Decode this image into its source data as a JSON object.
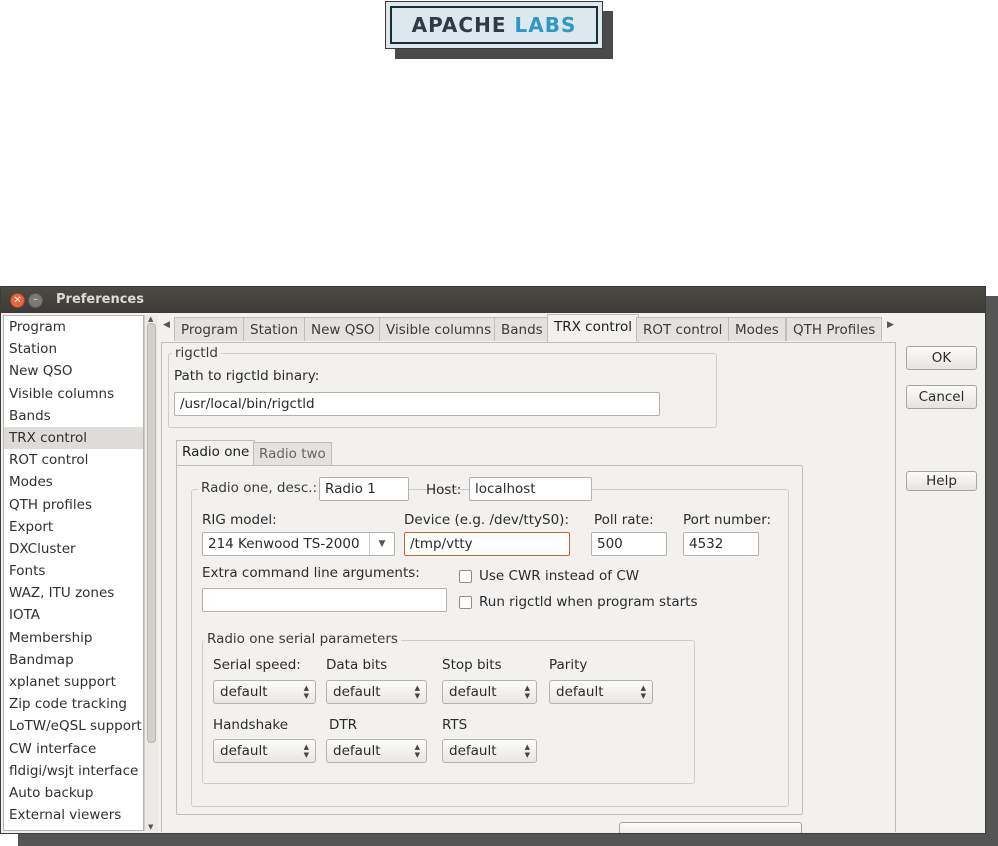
{
  "logo": {
    "apache": "APACHE",
    "labs": "LABS"
  },
  "window": {
    "title": "Preferences"
  },
  "sidebar": {
    "items": [
      {
        "label": "Program"
      },
      {
        "label": "Station"
      },
      {
        "label": "New QSO"
      },
      {
        "label": "Visible columns"
      },
      {
        "label": "Bands"
      },
      {
        "label": "TRX control"
      },
      {
        "label": "ROT control"
      },
      {
        "label": "Modes"
      },
      {
        "label": "QTH profiles"
      },
      {
        "label": "Export"
      },
      {
        "label": "DXCluster"
      },
      {
        "label": "Fonts"
      },
      {
        "label": "WAZ, ITU zones"
      },
      {
        "label": "IOTA"
      },
      {
        "label": "Membership"
      },
      {
        "label": "Bandmap"
      },
      {
        "label": "xplanet support"
      },
      {
        "label": "Zip code tracking"
      },
      {
        "label": "LoTW/eQSL support"
      },
      {
        "label": "CW interface"
      },
      {
        "label": "fldigi/wsjt interface"
      },
      {
        "label": "Auto backup"
      },
      {
        "label": "External viewers"
      }
    ],
    "selected": "TRX control"
  },
  "tabs": [
    "Program",
    "Station",
    "New QSO",
    "Visible columns",
    "Bands",
    "TRX control",
    "ROT control",
    "Modes",
    "QTH Profiles"
  ],
  "active_tab": "TRX control",
  "rigctld": {
    "group_title": "rigctld",
    "path_label": "Path to rigctld binary:",
    "path_value": "/usr/local/bin/rigctld"
  },
  "radio_tabs": [
    "Radio one",
    "Radio two"
  ],
  "radio": {
    "desc_label": "Radio one, desc.:",
    "desc_value": "Radio 1",
    "host_label": "Host:",
    "host_value": "localhost",
    "rig_model_label": "RIG model:",
    "rig_model_value": "214 Kenwood TS-2000",
    "device_label": "Device (e.g. /dev/ttyS0):",
    "device_value": "/tmp/vtty",
    "poll_label": "Poll rate:",
    "poll_value": "500",
    "port_label": "Port number:",
    "port_value": "4532",
    "extra_label": "Extra command line arguments:",
    "extra_value": "",
    "cwr_label": "Use CWR instead of CW",
    "cwr_checked": false,
    "run_label": "Run rigctld when program starts",
    "run_checked": false
  },
  "serial": {
    "group_title": "Radio one serial parameters",
    "speed_label": "Serial speed:",
    "speed_value": "default",
    "data_label": "Data bits",
    "data_value": "default",
    "stop_label": "Stop bits",
    "stop_value": "default",
    "parity_label": "Parity",
    "parity_value": "default",
    "handshake_label": "Handshake",
    "handshake_value": "default",
    "dtr_label": "DTR",
    "dtr_value": "default",
    "rts_label": "RTS",
    "rts_value": "default"
  },
  "buttons": {
    "ok": "OK",
    "cancel": "Cancel",
    "help": "Help"
  }
}
